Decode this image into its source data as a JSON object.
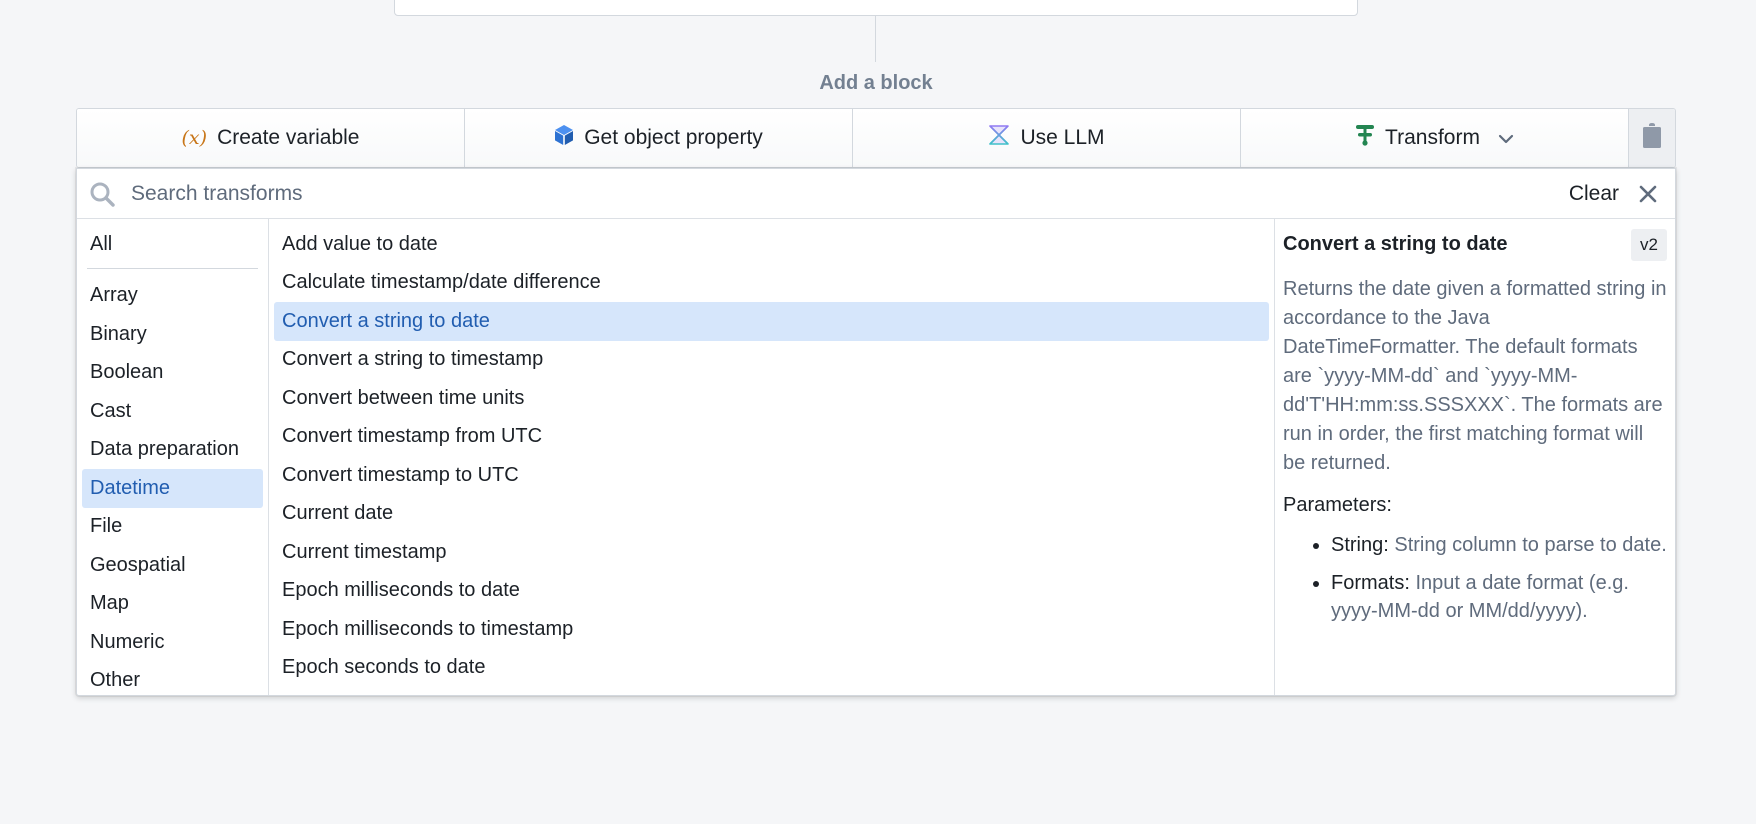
{
  "canvas": {
    "add_block_label": "Add a block"
  },
  "block_bar": {
    "buttons": [
      {
        "label": "Create variable",
        "icon": "variable-icon",
        "icon_glyph": "(x)"
      },
      {
        "label": "Get object property",
        "icon": "cube-icon"
      },
      {
        "label": "Use LLM",
        "icon": "llm-icon"
      },
      {
        "label": "Transform",
        "icon": "transform-icon",
        "has_dropdown": true
      }
    ],
    "clipboard_icon": "clipboard-icon"
  },
  "search": {
    "placeholder": "Search transforms",
    "value": "",
    "clear_label": "Clear"
  },
  "categories": {
    "all_label": "All",
    "items": [
      "Array",
      "Binary",
      "Boolean",
      "Cast",
      "Data preparation",
      "Datetime",
      "File",
      "Geospatial",
      "Map",
      "Numeric",
      "Other"
    ],
    "selected": "Datetime"
  },
  "functions": {
    "items": [
      "Add value to date",
      "Calculate timestamp/date difference",
      "Convert a string to date",
      "Convert a string to timestamp",
      "Convert between time units",
      "Convert timestamp from UTC",
      "Convert timestamp to UTC",
      "Current date",
      "Current timestamp",
      "Epoch milliseconds to date",
      "Epoch milliseconds to timestamp",
      "Epoch seconds to date"
    ],
    "selected": "Convert a string to date"
  },
  "detail": {
    "title": "Convert a string to date",
    "version": "v2",
    "description": "Returns the date given a formatted string in accordance to the Java DateTimeFormatter. The default formats are `yyyy-MM-dd` and `yyyy-MM-dd'T'HH:mm:ss.SSSXXX`. The formats are run in order, the first matching format will be returned.",
    "parameters_label": "Parameters:",
    "parameters": [
      {
        "name": "String:",
        "description": "String column to parse to date."
      },
      {
        "name": "Formats:",
        "description": "Input a date format (e.g. yyyy-MM-dd or MM/dd/yyyy)."
      }
    ]
  },
  "colors": {
    "accent_blue": "#215db0",
    "selection_bg": "#d6e6fb",
    "transform_green": "#238551",
    "variable_orange": "#c87619",
    "cube_blue": "#2d72d2"
  }
}
